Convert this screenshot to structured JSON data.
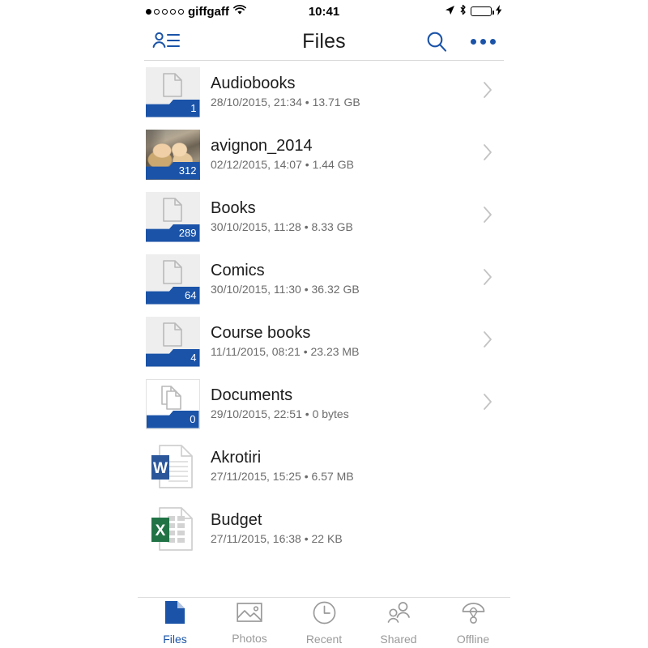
{
  "status_bar": {
    "signal_dots_total": 5,
    "signal_dots_filled": 1,
    "carrier": "giffgaff",
    "wifi_icon": "wifi-icon",
    "time": "10:41",
    "location_icon": "location-arrow-icon",
    "bluetooth_icon": "bluetooth-icon",
    "battery_icon": "battery-icon",
    "charging_icon": "charging-bolt-icon",
    "battery_color": "#4cd964"
  },
  "navbar": {
    "accounts_icon": "contacts-person-list-icon",
    "title": "Files",
    "search_icon": "search-icon",
    "overflow_icon": "overflow-menu-icon",
    "accent_color": "#1a53a8"
  },
  "list": {
    "items": [
      {
        "name": "Audiobooks",
        "subtitle": "28/10/2015, 21:34 • 13.71 GB",
        "kind": "folder",
        "count": "1",
        "thumb": "document-glyph",
        "thumb_bg": "grey",
        "has_chevron": true
      },
      {
        "name": "avignon_2014",
        "subtitle": "02/12/2015, 14:07 • 1.44 GB",
        "kind": "folder",
        "count": "312",
        "thumb": "photo-preview",
        "thumb_bg": "photo",
        "has_chevron": true
      },
      {
        "name": "Books",
        "subtitle": "30/10/2015, 11:28 • 8.33 GB",
        "kind": "folder",
        "count": "289",
        "thumb": "document-glyph",
        "thumb_bg": "grey",
        "has_chevron": true
      },
      {
        "name": "Comics",
        "subtitle": "30/10/2015, 11:30 • 36.32 GB",
        "kind": "folder",
        "count": "64",
        "thumb": "document-glyph",
        "thumb_bg": "grey",
        "has_chevron": true
      },
      {
        "name": "Course books",
        "subtitle": "11/11/2015, 08:21 • 23.23 MB",
        "kind": "folder",
        "count": "4",
        "thumb": "document-glyph",
        "thumb_bg": "grey",
        "has_chevron": true
      },
      {
        "name": "Documents",
        "subtitle": "29/10/2015, 22:51 • 0 bytes",
        "kind": "folder",
        "count": "0",
        "thumb": "stacked-documents-glyph",
        "thumb_bg": "white",
        "has_chevron": true
      },
      {
        "name": "Akrotiri",
        "subtitle": "27/11/2015, 15:25 • 6.57 MB",
        "kind": "file",
        "count": "",
        "thumb": "word-document-icon",
        "thumb_bg": "none",
        "has_chevron": false
      },
      {
        "name": "Budget",
        "subtitle": "27/11/2015, 16:38 • 22 KB",
        "kind": "file",
        "count": "",
        "thumb": "excel-spreadsheet-icon",
        "thumb_bg": "none",
        "has_chevron": false
      }
    ]
  },
  "tabbar": {
    "tabs": [
      {
        "label": "Files",
        "icon": "file-icon",
        "active": true
      },
      {
        "label": "Photos",
        "icon": "photo-icon",
        "active": false
      },
      {
        "label": "Recent",
        "icon": "clock-icon",
        "active": false
      },
      {
        "label": "Shared",
        "icon": "people-icon",
        "active": false
      },
      {
        "label": "Offline",
        "icon": "parachute-icon",
        "active": false
      }
    ]
  },
  "colors": {
    "accent": "#1a53a8",
    "word_blue": "#2b579a",
    "excel_green": "#217346",
    "inactive": "#9a9a9a"
  }
}
